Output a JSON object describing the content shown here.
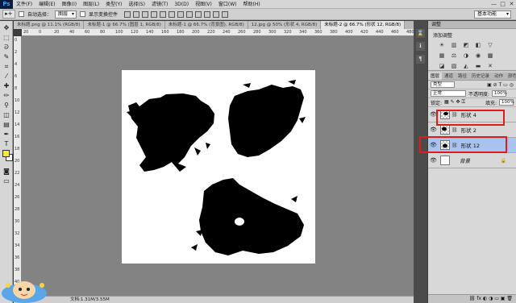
{
  "app": {
    "logo": "Ps"
  },
  "menu": [
    "文件(F)",
    "编辑(E)",
    "图像(I)",
    "图层(L)",
    "类型(Y)",
    "选择(S)",
    "滤镜(T)",
    "3D(D)",
    "视图(V)",
    "窗口(W)",
    "帮助(H)"
  ],
  "window_controls": [
    "—",
    "□",
    "✕"
  ],
  "options": {
    "tool_glyph": "▸+",
    "auto_select_label": "自动选择：",
    "auto_select_value": "图层",
    "show_transform_label": "显示变换控件",
    "workspace": "基本功能"
  },
  "tabs": [
    {
      "label": "未标题.png @ 11.1% (RGB/8)",
      "active": false
    },
    {
      "label": "未标题-1 @ 66.7% (图层 1, RGB/8)",
      "active": false
    },
    {
      "label": "未标题-1 @ 66.7% (背景图), RGB/8)",
      "active": false
    },
    {
      "label": "12.jpg @ 50% (形状 4, RGB/8)",
      "active": false
    },
    {
      "label": "未标题-2 @ 66.7% (形状 12, RGB/8)",
      "active": true
    }
  ],
  "ruler_top": [
    "20",
    "0",
    "20",
    "40",
    "60",
    "80",
    "100",
    "120",
    "140",
    "160",
    "180",
    "200",
    "220",
    "240",
    "260",
    "280",
    "300",
    "320",
    "340",
    "360",
    "380",
    "400",
    "420",
    "440",
    "460",
    "480"
  ],
  "ruler_left": [
    "0",
    "2",
    "4",
    "6",
    "8",
    "10",
    "12",
    "14",
    "16",
    "18",
    "20",
    "22",
    "24",
    "26",
    "28",
    "30",
    "32",
    "34",
    "36",
    "38",
    "40"
  ],
  "status": "文档:1.31M/3.55M",
  "adjustments": {
    "title": "调整",
    "subtitle": "添加调整"
  },
  "layers_panel": {
    "tabs": [
      "图层",
      "通道",
      "路径",
      "历史记录",
      "动作",
      "颜色",
      "色板",
      "样式"
    ],
    "active_tab": "图层",
    "filter": "类型",
    "blend_mode": "正常",
    "opacity_label": "不透明度:",
    "opacity_value": "100%",
    "lock_label": "锁定:",
    "fill_label": "填充:",
    "fill_value": "100%",
    "layers": [
      {
        "name": "形状 4",
        "visible": true,
        "selected": false,
        "highlighted": true
      },
      {
        "name": "形状 2",
        "visible": true,
        "selected": false,
        "highlighted": false
      },
      {
        "name": "形状 12",
        "visible": true,
        "selected": true,
        "highlighted": true
      },
      {
        "name": "背景",
        "visible": true,
        "selected": false,
        "highlighted": false,
        "locked": true
      }
    ]
  },
  "colors": {
    "foreground": "#f5e93c",
    "background": "#ffffff",
    "highlight": "#e11a1a",
    "selection": "#a8c4ee"
  }
}
